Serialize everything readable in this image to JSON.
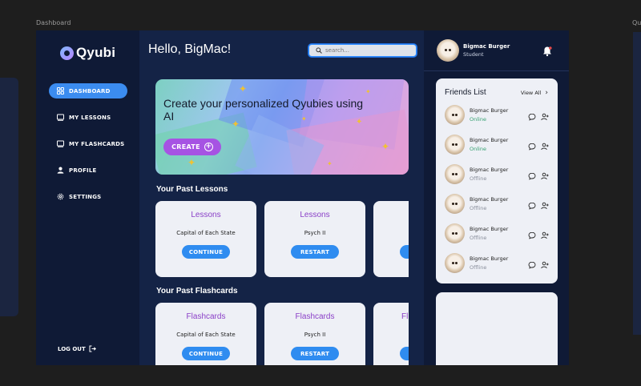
{
  "canvas": {
    "frame_label_left": "Dashboard",
    "frame_label_right": "Qu"
  },
  "brand": {
    "name": "Qyubi"
  },
  "sidebar": {
    "items": [
      {
        "label": "DASHBOARD",
        "icon": "dashboard-icon",
        "active": true
      },
      {
        "label": "MY LESSONS",
        "icon": "lessons-icon",
        "active": false
      },
      {
        "label": "MY FLASHCARDS",
        "icon": "flashcards-icon",
        "active": false
      },
      {
        "label": "PROFILE",
        "icon": "profile-icon",
        "active": false
      },
      {
        "label": "SETTINGS",
        "icon": "settings-icon",
        "active": false
      }
    ],
    "logout_label": "LOG OUT"
  },
  "header": {
    "greeting": "Hello, BigMac!",
    "search_placeholder": "search..."
  },
  "banner": {
    "title": "Create your personalized Qyubies using AI",
    "create_label": "CREATE"
  },
  "lessons": {
    "title": "Your Past Lessons",
    "cards": [
      {
        "type": "Lessons",
        "subject": "Capital of Each State",
        "action": "CONTINUE"
      },
      {
        "type": "Lessons",
        "subject": "Psych II",
        "action": "RESTART"
      },
      {
        "type": "",
        "subject": "",
        "action": ""
      }
    ]
  },
  "flashcards": {
    "title": "Your Past Flashcards",
    "cards": [
      {
        "type": "Flashcards",
        "subject": "Capital of Each State",
        "action": "CONTINUE"
      },
      {
        "type": "Flashcards",
        "subject": "Psych II",
        "action": "RESTART"
      },
      {
        "type": "Fl",
        "subject": "",
        "action": ""
      }
    ]
  },
  "user": {
    "name": "Bigmac Burger",
    "role": "Student"
  },
  "friends": {
    "title": "Friends List",
    "view_all": "View All",
    "list": [
      {
        "name": "Bigmac Burger",
        "status": "Online"
      },
      {
        "name": "Bigmac Burger",
        "status": "Online"
      },
      {
        "name": "Bigmac Burger",
        "status": "Offline"
      },
      {
        "name": "Bigmac Burger",
        "status": "Offline"
      },
      {
        "name": "Bigmac Burger",
        "status": "Offline"
      },
      {
        "name": "Bigmac Burger",
        "status": "Offline"
      }
    ]
  },
  "colors": {
    "background": "#142346",
    "sidebar": "#0f1a36",
    "accent_blue": "#3b8cf0",
    "accent_purple": "#a653e3",
    "online": "#35a070",
    "offline": "#8a8f9c"
  }
}
